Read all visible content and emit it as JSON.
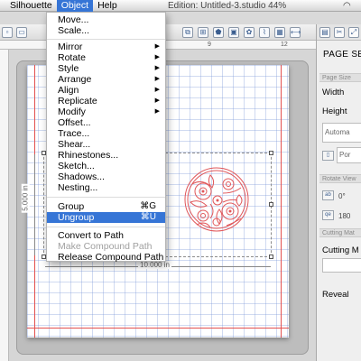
{
  "menubar": {
    "app": "Silhouette",
    "object": "Object",
    "help": "Help",
    "window_title": "Edition: Untitled-3.studio 44%"
  },
  "dropdown": {
    "items": [
      {
        "label": "Move..."
      },
      {
        "label": "Scale..."
      },
      {
        "label": "Mirror",
        "submenu": true
      },
      {
        "label": "Rotate",
        "submenu": true
      },
      {
        "label": "Style",
        "submenu": true
      },
      {
        "label": "Arrange",
        "submenu": true
      },
      {
        "label": "Align",
        "submenu": true
      },
      {
        "label": "Replicate",
        "submenu": true
      },
      {
        "label": "Modify",
        "submenu": true
      },
      {
        "label": "Offset..."
      },
      {
        "label": "Trace..."
      },
      {
        "label": "Shear..."
      },
      {
        "label": "Rhinestones..."
      },
      {
        "label": "Sketch..."
      },
      {
        "label": "Shadows..."
      },
      {
        "label": "Nesting..."
      },
      {
        "label": "Group",
        "shortcut": "⌘G"
      },
      {
        "label": "Ungroup",
        "shortcut": "⌘U",
        "highlighted": true
      },
      {
        "label": "Convert to Path"
      },
      {
        "label": "Make Compound Path",
        "disabled": true
      },
      {
        "label": "Release Compound Path"
      }
    ]
  },
  "ruler": {
    "h_numbers": [
      "9",
      "12"
    ]
  },
  "canvas": {
    "width_label": "10.000 in",
    "height_label": "5.000 in"
  },
  "panel": {
    "title": "PAGE SET",
    "page_size_section": "Page Size",
    "width_label": "Width",
    "height_label": "Height",
    "auto_field": "Automa",
    "portrait_field": "Por",
    "rotate_section": "Rotate View",
    "rotate_0": "0°",
    "rotate_180": "180",
    "cutting_section": "Cutting Mat",
    "cutting_label": "Cutting M",
    "reveal_label": "Reveal"
  },
  "colors": {
    "menu_highlight": "#3675d6",
    "ornament": "#e0575a",
    "grid_line": "#7896d7"
  }
}
